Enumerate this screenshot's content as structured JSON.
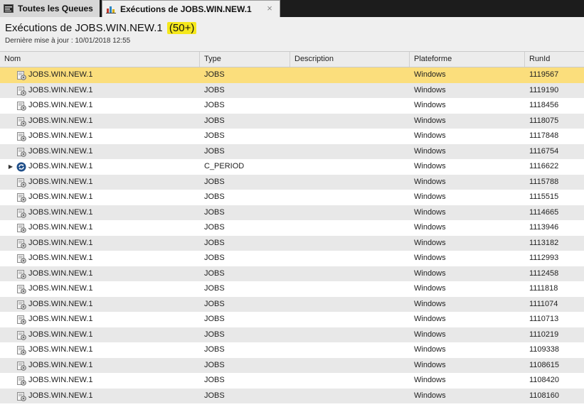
{
  "tabs": [
    {
      "label": "Toutes les Queues",
      "icon": "queue-window-icon"
    },
    {
      "label": "Exécutions de JOBS.WIN.NEW.1",
      "icon": "bar-chart-icon",
      "close": "×"
    }
  ],
  "header": {
    "title": "Exécutions de JOBS.WIN.NEW.1",
    "count": "(50+)",
    "subtitle": "Dernière mise à jour : 10/01/2018 12:55"
  },
  "columns": {
    "name": "Nom",
    "type": "Type",
    "description": "Description",
    "platform": "Plateforme",
    "runid": "RunId"
  },
  "rows": [
    {
      "name": "JOBS.WIN.NEW.1",
      "type": "JOBS",
      "description": "",
      "platform": "Windows",
      "runid": "1119567",
      "selected": true
    },
    {
      "name": "JOBS.WIN.NEW.1",
      "type": "JOBS",
      "description": "",
      "platform": "Windows",
      "runid": "1119190"
    },
    {
      "name": "JOBS.WIN.NEW.1",
      "type": "JOBS",
      "description": "",
      "platform": "Windows",
      "runid": "1118456"
    },
    {
      "name": "JOBS.WIN.NEW.1",
      "type": "JOBS",
      "description": "",
      "platform": "Windows",
      "runid": "1118075"
    },
    {
      "name": "JOBS.WIN.NEW.1",
      "type": "JOBS",
      "description": "",
      "platform": "Windows",
      "runid": "1117848"
    },
    {
      "name": "JOBS.WIN.NEW.1",
      "type": "JOBS",
      "description": "",
      "platform": "Windows",
      "runid": "1116754"
    },
    {
      "name": "JOBS.WIN.NEW.1",
      "type": "C_PERIOD",
      "description": "",
      "platform": "Windows",
      "runid": "1116622",
      "expandable": true,
      "icon": "period-icon"
    },
    {
      "name": "JOBS.WIN.NEW.1",
      "type": "JOBS",
      "description": "",
      "platform": "Windows",
      "runid": "1115788"
    },
    {
      "name": "JOBS.WIN.NEW.1",
      "type": "JOBS",
      "description": "",
      "platform": "Windows",
      "runid": "1115515"
    },
    {
      "name": "JOBS.WIN.NEW.1",
      "type": "JOBS",
      "description": "",
      "platform": "Windows",
      "runid": "1114665"
    },
    {
      "name": "JOBS.WIN.NEW.1",
      "type": "JOBS",
      "description": "",
      "platform": "Windows",
      "runid": "1113946"
    },
    {
      "name": "JOBS.WIN.NEW.1",
      "type": "JOBS",
      "description": "",
      "platform": "Windows",
      "runid": "1113182"
    },
    {
      "name": "JOBS.WIN.NEW.1",
      "type": "JOBS",
      "description": "",
      "platform": "Windows",
      "runid": "1112993"
    },
    {
      "name": "JOBS.WIN.NEW.1",
      "type": "JOBS",
      "description": "",
      "platform": "Windows",
      "runid": "1112458"
    },
    {
      "name": "JOBS.WIN.NEW.1",
      "type": "JOBS",
      "description": "",
      "platform": "Windows",
      "runid": "1111818"
    },
    {
      "name": "JOBS.WIN.NEW.1",
      "type": "JOBS",
      "description": "",
      "platform": "Windows",
      "runid": "1111074"
    },
    {
      "name": "JOBS.WIN.NEW.1",
      "type": "JOBS",
      "description": "",
      "platform": "Windows",
      "runid": "1110713"
    },
    {
      "name": "JOBS.WIN.NEW.1",
      "type": "JOBS",
      "description": "",
      "platform": "Windows",
      "runid": "1110219"
    },
    {
      "name": "JOBS.WIN.NEW.1",
      "type": "JOBS",
      "description": "",
      "platform": "Windows",
      "runid": "1109338"
    },
    {
      "name": "JOBS.WIN.NEW.1",
      "type": "JOBS",
      "description": "",
      "platform": "Windows",
      "runid": "1108615"
    },
    {
      "name": "JOBS.WIN.NEW.1",
      "type": "JOBS",
      "description": "",
      "platform": "Windows",
      "runid": "1108420"
    },
    {
      "name": "JOBS.WIN.NEW.1",
      "type": "JOBS",
      "description": "",
      "platform": "Windows",
      "runid": "1108160"
    }
  ],
  "colors": {
    "selected_row": "#fbde7c",
    "alt_row": "#e8e8e8",
    "count_highlight": "#f5e81b",
    "tabbar": "#1c1c1c"
  }
}
